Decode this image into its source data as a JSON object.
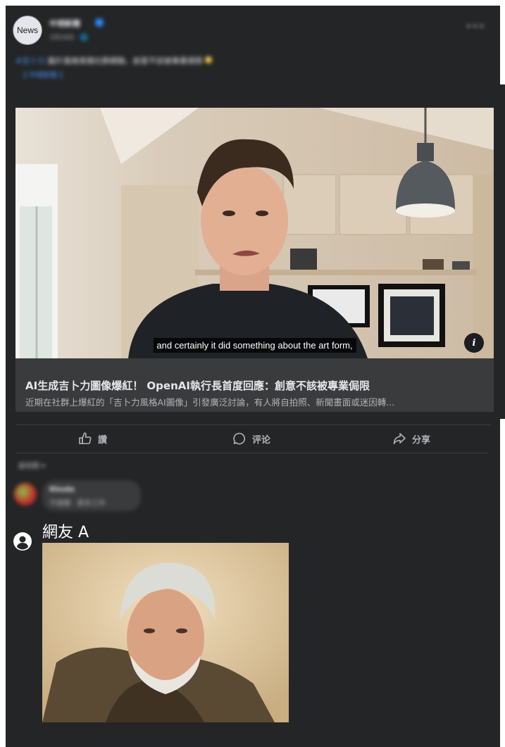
{
  "post": {
    "avatar_text": "News",
    "page_name": "中視新聞",
    "meta": "3月29日 · 🌐",
    "text_hashtag": "#吉卜力",
    "text_body": " 圖片風格席捲社群網路，創意不該被專業侷限 ",
    "see_more": "【 中視新聞 】"
  },
  "video": {
    "caption": "and certainly it did something about the art form,",
    "info_icon": "i"
  },
  "link_card": {
    "title": "AI生成吉卜力圖像爆紅！ OpenAI執行長首度回應：創意不該被專業侷限",
    "description": "近期在社群上爆紅的「吉卜力風格AI圖像」引發廣泛討論，有人將自拍照、新聞畫面或迷因轉..."
  },
  "actions": {
    "like": "讚",
    "comment": "评论",
    "share": "分享"
  },
  "comments": {
    "sort_label": "最相關 ▾",
    "first": {
      "name": "Rhoda",
      "text": "不錯喔 · 更多工作"
    },
    "netizen_name": "網友 A"
  },
  "colors": {
    "panel": "#242526",
    "card": "#3a3b3c",
    "text": "#e4e6eb",
    "muted": "#b0b3b8",
    "accent": "#2d88ff"
  },
  "icons": [
    "more-icon",
    "info-icon",
    "like-icon",
    "comment-icon",
    "share-icon",
    "user-icon",
    "verified-badge-icon"
  ]
}
